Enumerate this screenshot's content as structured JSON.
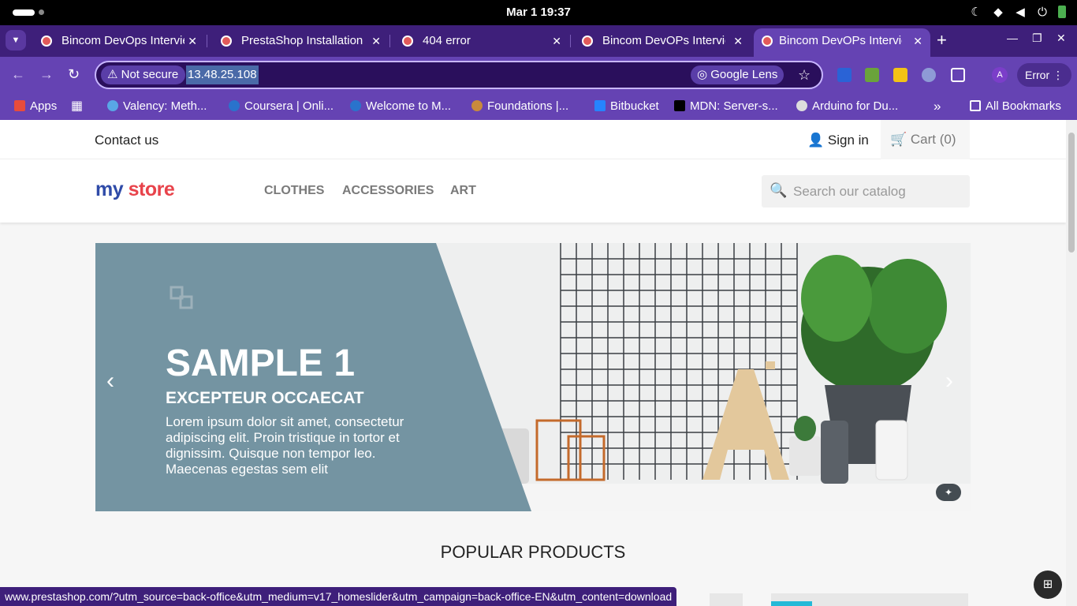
{
  "os": {
    "clock": "Mar 1  19:37"
  },
  "tabs": [
    {
      "title": "Bincom DevOps Intervie",
      "active": false
    },
    {
      "title": "PrestaShop Installation",
      "active": false
    },
    {
      "title": "404 error",
      "active": false
    },
    {
      "title": "Bincom DevOPs Intervie",
      "active": false
    },
    {
      "title": "Bincom DevOPs Intervie",
      "active": true
    }
  ],
  "toolbar": {
    "security_label": "Not secure",
    "url": "13.48.25.108",
    "lens_label": "Google Lens",
    "profile_initial": "A",
    "error_label": "Error"
  },
  "bookmarks": [
    {
      "label": "Apps",
      "icon": "apps-icon"
    },
    {
      "label": "Valency: Meth...",
      "icon": "valency-icon"
    },
    {
      "label": "Coursera | Onli...",
      "icon": "coursera-icon"
    },
    {
      "label": "Welcome to M...",
      "icon": "coursera-icon"
    },
    {
      "label": "Foundations |...",
      "icon": "owl-icon"
    },
    {
      "label": "Bitbucket",
      "icon": "bitbucket-icon"
    },
    {
      "label": "MDN: Server-s...",
      "icon": "mdn-icon"
    },
    {
      "label": "Arduino for Du...",
      "icon": "globe-icon"
    },
    {
      "label": "All Bookmarks",
      "icon": "folder-icon"
    }
  ],
  "store": {
    "contact": "Contact us",
    "signin": "Sign in",
    "cart": "Cart (0)",
    "logo_my": "my",
    "logo_store": "store",
    "menu": [
      "CLOTHES",
      "ACCESSORIES",
      "ART"
    ],
    "search_placeholder": "Search our catalog",
    "slide": {
      "title": "SAMPLE 1",
      "subtitle": "EXCEPTEUR OCCAECAT",
      "text": "Lorem ipsum dolor sit amet, consectetur adipiscing elit. Proin tristique in tortor et dignissim. Quisque non tempor leo. Maecenas egestas sem elit"
    },
    "popular_heading": "POPULAR PRODUCTS"
  },
  "status_url": "www.prestashop.com/?utm_source=back-office&utm_medium=v17_homeslider&utm_campaign=back-office-EN&utm_content=download",
  "colors": {
    "tabbar": "#3e1f7a",
    "toolbar": "#6543b3",
    "slide_panel": "#7494a2",
    "logo_blue": "#2f4ba8",
    "logo_red": "#e8434b"
  }
}
